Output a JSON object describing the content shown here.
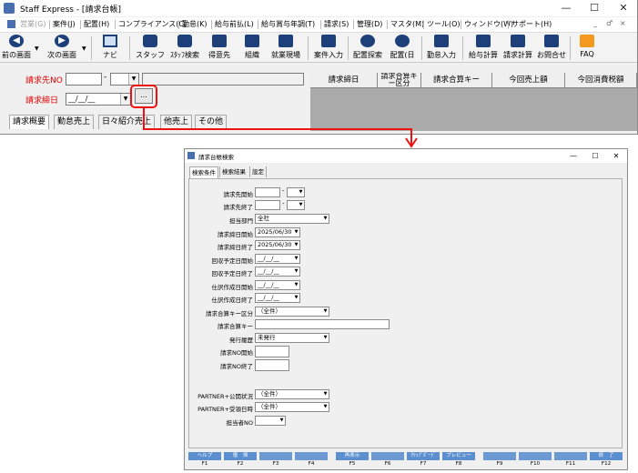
{
  "main_window": {
    "title": "Staff Express - [請求台帳]",
    "win_controls": [
      "—",
      "☐",
      "✕"
    ],
    "menu": [
      {
        "label": "営業(G)",
        "disabled": true
      },
      {
        "label": "案件(J)"
      },
      {
        "label": "配置(H)"
      },
      {
        "label": "コンプライアンス(C)"
      },
      {
        "label": "勤怠(K)"
      },
      {
        "label": "給与前払(L)"
      },
      {
        "label": "給与賞与年調(T)"
      },
      {
        "label": "請求(S)"
      },
      {
        "label": "管理(D)"
      },
      {
        "label": "マスタ(M)"
      },
      {
        "label": "ツール(O)"
      },
      {
        "label": "ウィンドウ(W)"
      },
      {
        "label": "サポート(H)"
      }
    ],
    "menu_right": [
      "_",
      "♂",
      "×"
    ],
    "toolbar": [
      {
        "label": "前の画面",
        "icon": "back-arrow-icon"
      },
      {
        "label": "次の画面",
        "icon": "forward-arrow-icon"
      },
      {
        "label": "ナビ",
        "icon": "navi-icon"
      },
      {
        "label": "スタッフ",
        "icon": "staff-icon"
      },
      {
        "label": "ｽﾀｯﾌ検索",
        "icon": "staff-search-icon"
      },
      {
        "label": "得意先",
        "icon": "client-icon"
      },
      {
        "label": "組織",
        "icon": "organization-icon"
      },
      {
        "label": "就業現場",
        "icon": "worksite-icon"
      },
      {
        "label": "案件入力",
        "icon": "case-entry-icon"
      },
      {
        "label": "配置探索",
        "icon": "placement-search-icon"
      },
      {
        "label": "配置(日",
        "icon": "placement-daily-icon"
      },
      {
        "label": "勤怠入力",
        "icon": "attendance-entry-icon"
      },
      {
        "label": "給与計算",
        "icon": "payroll-icon"
      },
      {
        "label": "請求計算",
        "icon": "billing-calc-icon"
      },
      {
        "label": "お問合せ",
        "icon": "inquiry-icon"
      },
      {
        "label": "FAQ",
        "icon": "faq-icon"
      }
    ],
    "form": {
      "billing_no_label": "請求先NO",
      "billing_no_dash": "-",
      "closing_date_label": "請求締日",
      "closing_date_value": "__/__/__",
      "ellipsis": "..."
    },
    "tabs": [
      "請求概要",
      "勤怠売上",
      "日々紹介売上",
      "他売上",
      "その他"
    ],
    "grid_headers": [
      "請求締日",
      "請求合算キー区分",
      "請求合算キー",
      "今回売上額",
      "今回消費税額"
    ]
  },
  "dialog": {
    "title": "請求台帳検索",
    "win_controls": [
      "—",
      "☐",
      "✕"
    ],
    "tabs": [
      "検索条件",
      "検索結果",
      "設定"
    ],
    "fields": [
      {
        "label": "請求先開始",
        "value": "",
        "kind": "code"
      },
      {
        "label": "請求先終了",
        "value": "",
        "kind": "code"
      },
      {
        "label": "担当部門",
        "value": "全社",
        "kind": "select"
      },
      {
        "label": "請求締日開始",
        "value": "2025/06/30",
        "kind": "date"
      },
      {
        "label": "請求締日終了",
        "value": "2025/06/30",
        "kind": "date"
      },
      {
        "label": "回収予定日開始",
        "value": "__/__/__",
        "kind": "date"
      },
      {
        "label": "回収予定日終了",
        "value": "__/__/__",
        "kind": "date"
      },
      {
        "label": "仕訳作成日開始",
        "value": "__/__/__",
        "kind": "date"
      },
      {
        "label": "仕訳作成日終了",
        "value": "__/__/__",
        "kind": "date"
      },
      {
        "label": "請求合算キー区分",
        "value": "（全件）",
        "kind": "select"
      },
      {
        "label": "請求合算キー",
        "value": "",
        "kind": "text"
      },
      {
        "label": "発行履歴",
        "value": "未発行",
        "kind": "select"
      },
      {
        "label": "請求NO開始",
        "value": "",
        "kind": "small"
      },
      {
        "label": "請求NO終了",
        "value": "",
        "kind": "small"
      },
      {
        "label": "PARTNER+公開状況",
        "value": "（全件）",
        "kind": "select"
      },
      {
        "label": "PARTNER+受領日時",
        "value": "（全件）",
        "kind": "select"
      },
      {
        "label": "担当者NO",
        "value": "",
        "kind": "mini"
      }
    ],
    "fkeys": [
      {
        "label": "ヘルプ",
        "num": "F1"
      },
      {
        "label": "復　帰",
        "num": "F2"
      },
      {
        "label": "",
        "num": "F3"
      },
      {
        "label": "",
        "num": "F4"
      },
      {
        "label": "再表示",
        "num": "F5"
      },
      {
        "label": "",
        "num": "F6"
      },
      {
        "label": "ｸﾘｯﾌﾟﾎﾞｰﾄﾞ",
        "num": "F7"
      },
      {
        "label": "プレビュー",
        "num": "F8"
      },
      {
        "label": "",
        "num": "F9"
      },
      {
        "label": "",
        "num": "F10"
      },
      {
        "label": "",
        "num": "F11"
      },
      {
        "label": "終　了",
        "num": "F12"
      }
    ]
  },
  "colors": {
    "accent_red": "#e00000",
    "fkey_blue": "#5b8fd0",
    "toolbar_icon": "#1d3f7a"
  }
}
